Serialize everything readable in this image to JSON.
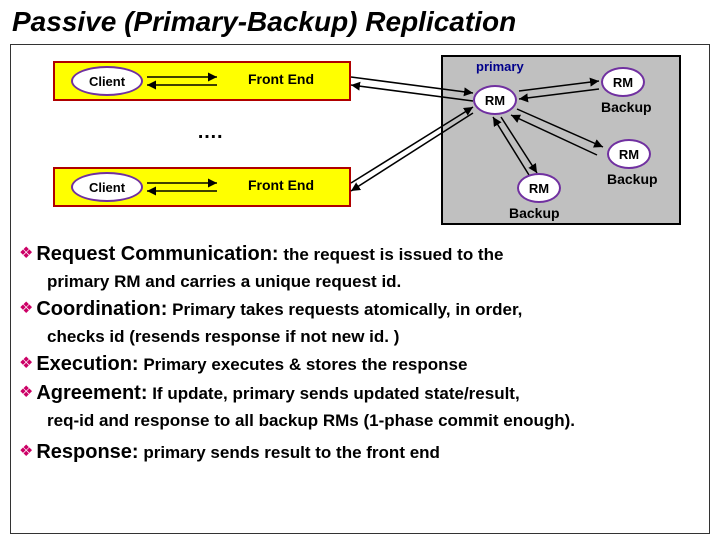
{
  "title": "Passive (Primary-Backup) Replication",
  "diagram": {
    "client": "Client",
    "frontend": "Front End",
    "primary_label": "primary",
    "rm": "RM",
    "backup": "Backup",
    "dots": "…."
  },
  "bullets": [
    {
      "lead": "Request Communication:",
      "body": " the request is issued to the",
      "cont": "primary RM and carries a unique request id."
    },
    {
      "lead": "Coordination:",
      "body": " Primary takes requests atomically, in order,",
      "cont": "checks id (resends response if not new id. )"
    },
    {
      "lead": "Execution:",
      "body": " Primary executes & stores the response",
      "cont": null
    },
    {
      "lead": "Agreement:",
      "body": " If update, primary sends updated state/result,",
      "cont": "req-id and response to all backup RMs (1-phase commit enough)."
    },
    {
      "lead": "Response:",
      "body": " primary sends result to the front end",
      "cont": null
    }
  ]
}
